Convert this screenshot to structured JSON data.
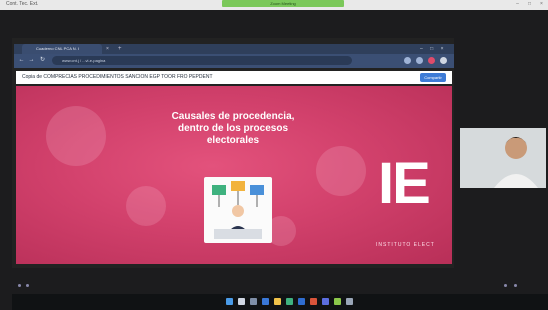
{
  "app": {
    "title": "Cont. Tec. Ext.",
    "indicator": "Zoom Meeting"
  },
  "browser": {
    "tab_label": "Cuaderno CNL PCA N. I",
    "url": "www.cnt.j / ...vi-e-pagina",
    "doc_title": "Copia de COMPRECIAS PROCEDIMIENTOS SANCION EGP TOOR FRO PEPDENT",
    "share_label": "Compartir"
  },
  "slide": {
    "title": "Causales de procedencia, dentro de los procesos electorales",
    "logo": "IE",
    "logo_sub": "INSTITUTO ELECT"
  },
  "colors": {
    "slide_pink": "#d2416c",
    "accent_blue": "#3d7bd6"
  },
  "icons": [
    "back-icon",
    "forward-icon",
    "refresh-icon",
    "home-icon",
    "start-icon",
    "search-icon",
    "browser-icon",
    "files-icon"
  ]
}
